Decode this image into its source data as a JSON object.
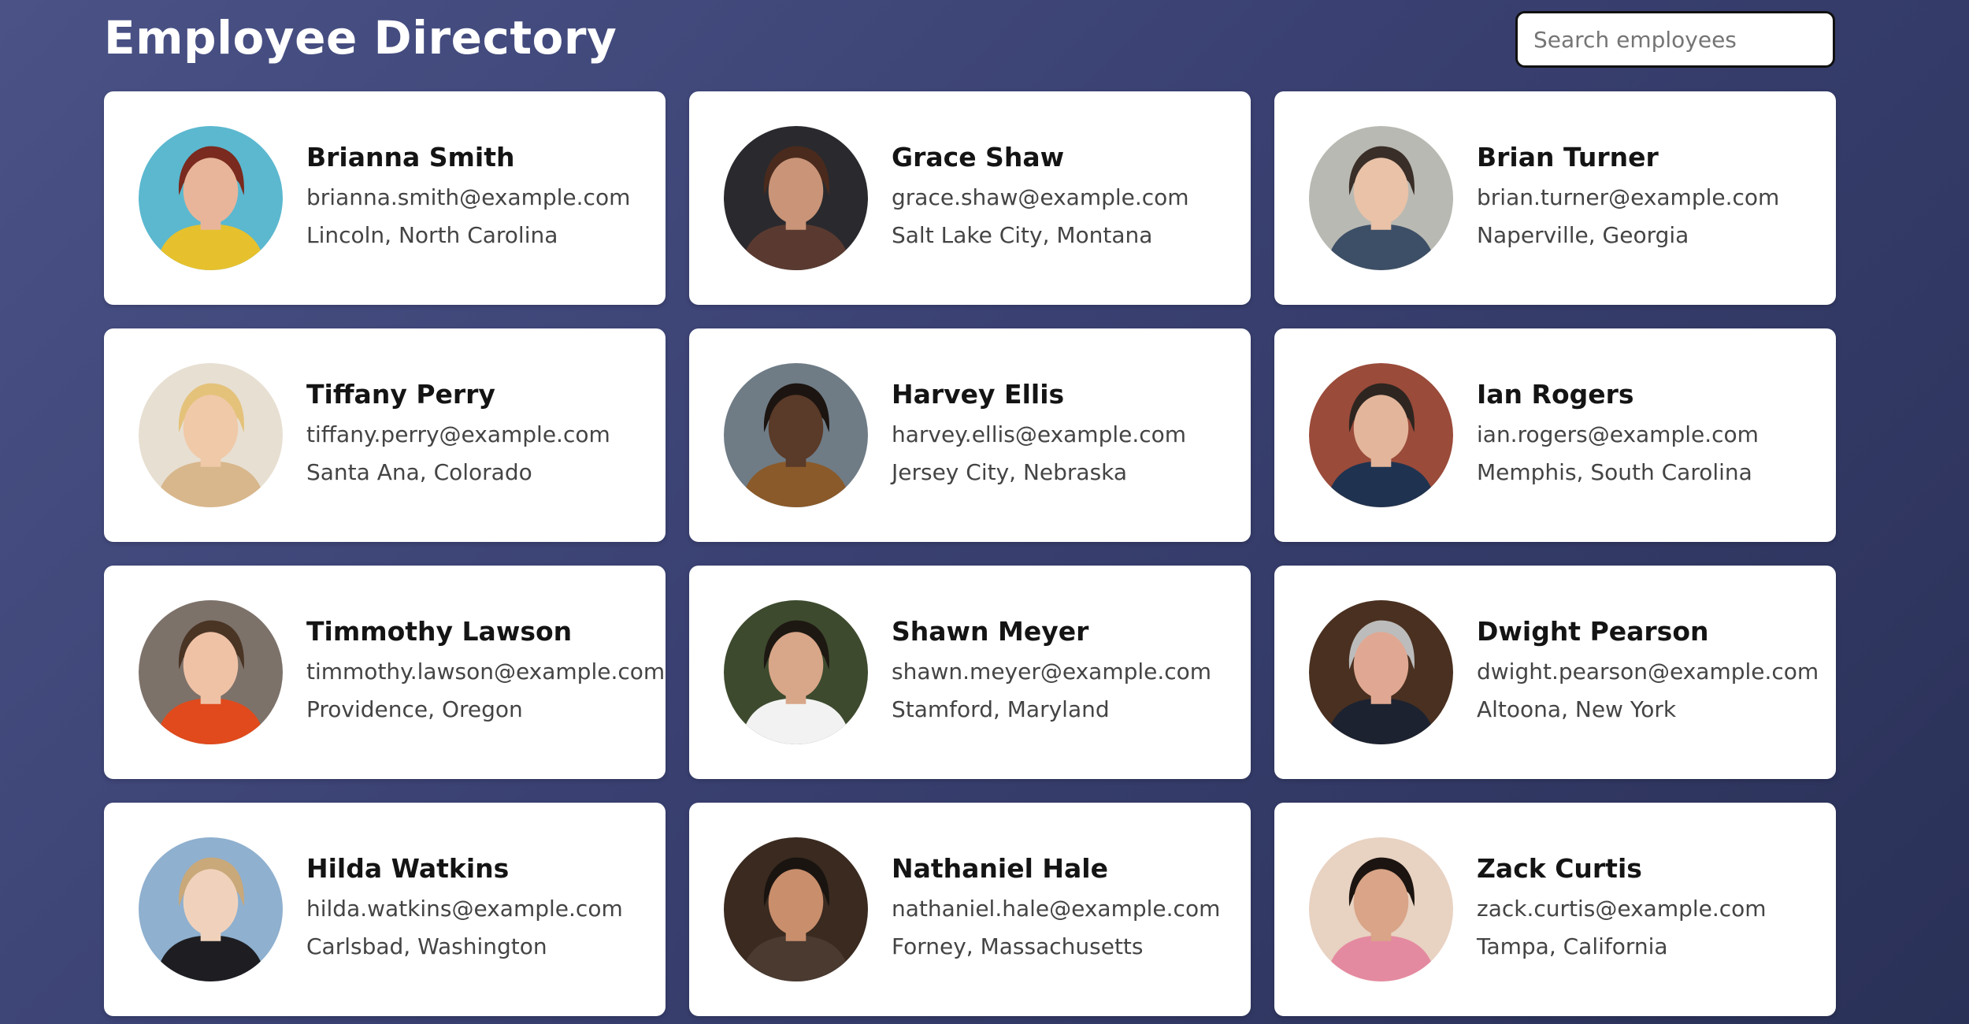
{
  "header": {
    "title": "Employee Directory",
    "search_placeholder": "Search employees",
    "search_value": ""
  },
  "employees": [
    {
      "name": "Brianna Smith",
      "email": "brianna.smith@example.com",
      "location": "Lincoln, North Carolina",
      "avatar": {
        "bg": "#5bb8cf",
        "skin": "#e8b59a",
        "hair": "#7a2a1e",
        "shirt": "#e6c12d"
      }
    },
    {
      "name": "Grace Shaw",
      "email": "grace.shaw@example.com",
      "location": "Salt Lake City, Montana",
      "avatar": {
        "bg": "#2a2a2e",
        "skin": "#c99478",
        "hair": "#4a2a1c",
        "shirt": "#5a3a30"
      }
    },
    {
      "name": "Brian Turner",
      "email": "brian.turner@example.com",
      "location": "Naperville, Georgia",
      "avatar": {
        "bg": "#b9b9b3",
        "skin": "#e9c2a8",
        "hair": "#3a2e28",
        "shirt": "#3d4f66"
      }
    },
    {
      "name": "Tiffany Perry",
      "email": "tiffany.perry@example.com",
      "location": "Santa Ana, Colorado",
      "avatar": {
        "bg": "#e7dfd2",
        "skin": "#f0c9a8",
        "hair": "#e4c27a",
        "shirt": "#d8b78c"
      }
    },
    {
      "name": "Harvey Ellis",
      "email": "harvey.ellis@example.com",
      "location": "Jersey City, Nebraska",
      "avatar": {
        "bg": "#6f7c86",
        "skin": "#5a3a28",
        "hair": "#1c1410",
        "shirt": "#8a5a2a"
      }
    },
    {
      "name": "Ian Rogers",
      "email": "ian.rogers@example.com",
      "location": "Memphis, South Carolina",
      "avatar": {
        "bg": "#9a4b3a",
        "skin": "#e3b59a",
        "hair": "#2e2520",
        "shirt": "#1f3350"
      }
    },
    {
      "name": "Timmothy Lawson",
      "email": "timmothy.lawson@example.com",
      "location": "Providence, Oregon",
      "avatar": {
        "bg": "#7d726a",
        "skin": "#efc2a6",
        "hair": "#4a3424",
        "shirt": "#e04a1c"
      }
    },
    {
      "name": "Shawn Meyer",
      "email": "shawn.meyer@example.com",
      "location": "Stamford, Maryland",
      "avatar": {
        "bg": "#3d4a2e",
        "skin": "#d8a688",
        "hair": "#1e1812",
        "shirt": "#f2f2f2"
      }
    },
    {
      "name": "Dwight Pearson",
      "email": "dwight.pearson@example.com",
      "location": "Altoona, New York",
      "avatar": {
        "bg": "#4a3020",
        "skin": "#e0a892",
        "hair": "#bcbcbc",
        "shirt": "#1c2230"
      }
    },
    {
      "name": "Hilda Watkins",
      "email": "hilda.watkins@example.com",
      "location": "Carlsbad, Washington",
      "avatar": {
        "bg": "#8fb0cf",
        "skin": "#f0d2bc",
        "hair": "#c9a87a",
        "shirt": "#1e1e22"
      }
    },
    {
      "name": "Nathaniel Hale",
      "email": "nathaniel.hale@example.com",
      "location": "Forney, Massachusetts",
      "avatar": {
        "bg": "#3a2a20",
        "skin": "#c98e6c",
        "hair": "#1a1410",
        "shirt": "#4a3a30"
      }
    },
    {
      "name": "Zack Curtis",
      "email": "zack.curtis@example.com",
      "location": "Tampa, California",
      "avatar": {
        "bg": "#e8d2c2",
        "skin": "#d9a487",
        "hair": "#1c1410",
        "shirt": "#e48aa0"
      }
    }
  ]
}
